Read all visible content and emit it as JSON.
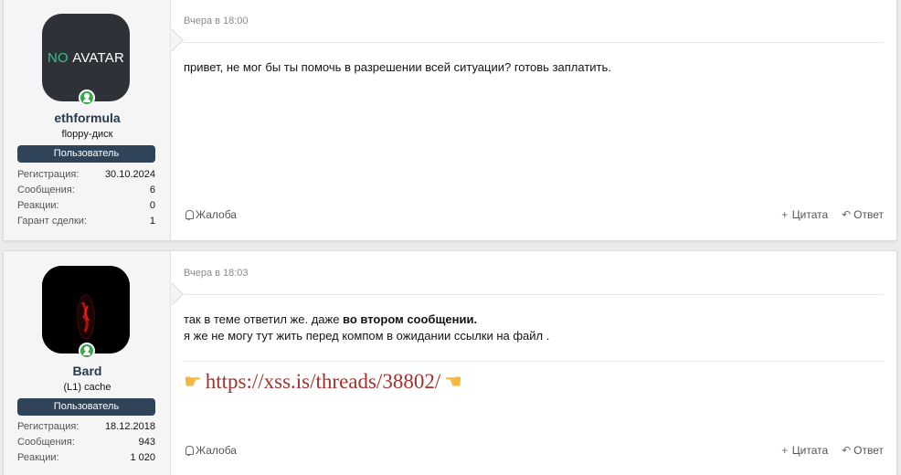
{
  "posts": [
    {
      "avatar": {
        "type": "no-avatar",
        "text_no": "NO",
        "text_avatar": "AVATAR",
        "online": true
      },
      "username": "ethformula",
      "user_title": "floppy-диск",
      "banner": "Пользователь",
      "stats": [
        {
          "label": "Регистрация:",
          "value": "30.10.2024"
        },
        {
          "label": "Сообщения:",
          "value": "6"
        },
        {
          "label": "Реакции:",
          "value": "0"
        },
        {
          "label": "Гарант сделки:",
          "value": "1"
        }
      ],
      "date": "Вчера в 18:00",
      "message": "привет, не мог бы ты помочь в разрешении всей ситуации? готовь заплатить.",
      "actions": {
        "report": "Жалоба",
        "quote": "Цитата",
        "reply": "Ответ"
      }
    },
    {
      "avatar": {
        "type": "image",
        "online": true
      },
      "username": "Bard",
      "user_title": "(L1) cache",
      "banner": "Пользователь",
      "stats": [
        {
          "label": "Регистрация:",
          "value": "18.12.2018"
        },
        {
          "label": "Сообщения:",
          "value": "943"
        },
        {
          "label": "Реакции:",
          "value": "1 020"
        }
      ],
      "date": "Вчера в 18:03",
      "message_line1_prefix": "так в теме ответил же. даже ",
      "message_line1_bold": "во втором сообщении.",
      "message_line2": "я же не могу тут жить перед компом в ожидании ссылки на файл .",
      "link": "https://xss.is/threads/38802/",
      "actions": {
        "report": "Жалоба",
        "quote": "Цитата",
        "reply": "Ответ"
      }
    }
  ],
  "icons": {
    "report": "bell-icon",
    "quote": "plus-icon",
    "reply": "reply-icon",
    "pointing": "pointing-hand-icon"
  },
  "colors": {
    "username": "#263a4f",
    "banner": "#2f4459",
    "link": "#a2312e",
    "online": "#3aa54a",
    "no_avatar_green": "#3cc08a"
  }
}
